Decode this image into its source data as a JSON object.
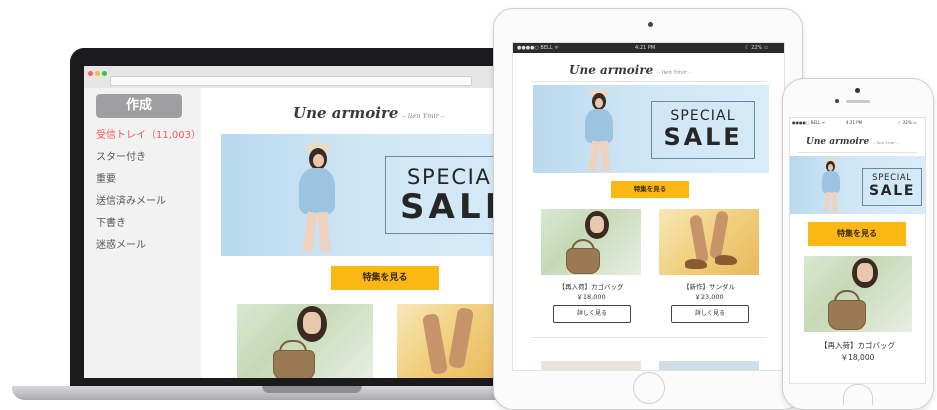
{
  "mail_client": {
    "compose_label": "作成",
    "folders": [
      {
        "label": "受信トレイ（11,003）",
        "active": true
      },
      {
        "label": "スター付き",
        "active": false
      },
      {
        "label": "重要",
        "active": false
      },
      {
        "label": "送信済みメール",
        "active": false
      },
      {
        "label": "下書き",
        "active": false
      },
      {
        "label": "迷惑メール",
        "active": false
      }
    ]
  },
  "newsletter": {
    "brand": "Une armoire",
    "brand_subtitle": "– lien Ymir –",
    "hero": {
      "line1": "SPECIAL",
      "line2": "SALE"
    },
    "cta_label": "特集を見る",
    "products": [
      {
        "name": "【再入荷】カゴバッグ",
        "price": "￥18,000",
        "detail_label": "詳しく見る"
      },
      {
        "name": "【新作】サンダル",
        "price": "￥23,000",
        "detail_label": "詳しく見る"
      }
    ]
  },
  "tablet_status": {
    "carrier": "●●●●○ BELL ᯤ",
    "time": "4:21 PM",
    "battery": "☾ 22% ▭"
  },
  "phone_status": {
    "carrier": "●●●●○ BELL ᯤ",
    "time": "4:21 PM",
    "battery": "☾ 22% ▭"
  },
  "colors": {
    "accent": "#fbb714",
    "inbox_active": "#f25a5a",
    "hero_bg": "#cfe6f5"
  }
}
